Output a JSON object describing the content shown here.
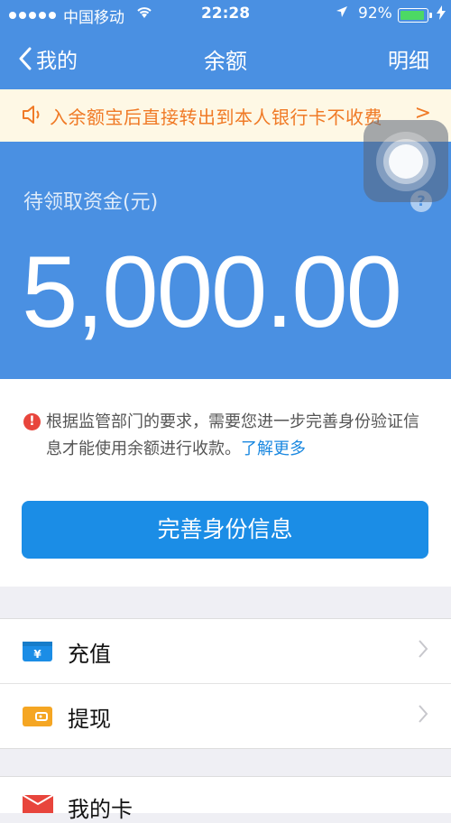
{
  "status_bar": {
    "carrier": "中国移动",
    "time": "22:28",
    "battery_percent": "92%",
    "battery_level": 0.92,
    "battery_color": "#4cd964"
  },
  "nav": {
    "back_label": "我的",
    "title": "余额",
    "detail_label": "明细"
  },
  "notice": {
    "text": "入余额宝后直接转出到本人银行卡不收费",
    "arrow": ">"
  },
  "balance": {
    "label": "待领取资金(元)",
    "amount": "5,000.00",
    "help_icon": "?"
  },
  "warning": {
    "icon": "!",
    "text": "根据监管部门的要求，需要您进一步完善身份验证信息才能使用余额进行收款。",
    "link": "了解更多"
  },
  "primary_button": "完善身份信息",
  "menu": [
    {
      "label": "充值",
      "icon": "recharge-icon",
      "color": "#1b8de6"
    },
    {
      "label": "提现",
      "icon": "wallet-icon",
      "color": "#f5a623"
    }
  ],
  "partial_row": {
    "label": "我的卡",
    "icon": "envelope-icon",
    "color": "#e8453c"
  },
  "colors": {
    "header_bg": "#4a90e2",
    "notice_text": "#f07a26",
    "button_bg": "#1b8de6",
    "link": "#1a88e0"
  }
}
